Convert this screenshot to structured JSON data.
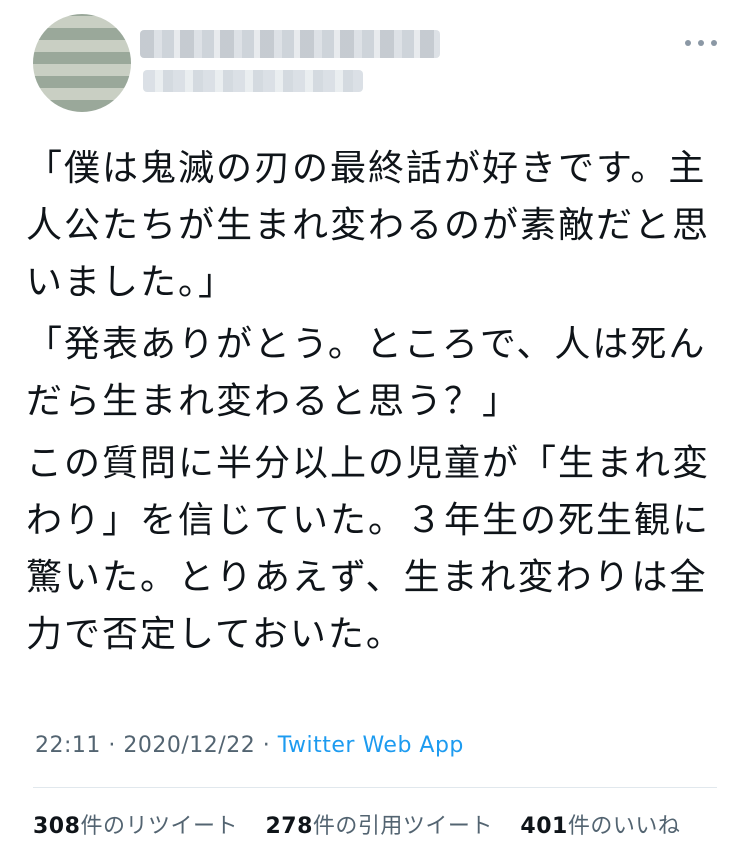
{
  "tweet": {
    "paragraphs": [
      "「僕は鬼滅の刃の最終話が好きです。主人公たちが生まれ変わるのが素敵だと思いました。」",
      "「発表ありがとう。ところで、人は死んだら生まれ変わると思う？」",
      "この質問に半分以上の児童が「生まれ変わり」を信じていた。３年生の死生観に驚いた。とりあえず、生まれ変わりは全力で否定しておいた。"
    ],
    "time": "22:11",
    "date": "2020/12/22",
    "separator": "·",
    "source": "Twitter Web App"
  },
  "stats": {
    "retweets_count": "308",
    "retweets_label": "件のリツイート",
    "quotes_count": "278",
    "quotes_label": "件の引用ツイート",
    "likes_count": "401",
    "likes_label": "件のいいね"
  },
  "colors": {
    "text": "#0f1419",
    "secondary": "#536471",
    "link": "#1d9bf0"
  },
  "icons": {
    "more": "more-horizontal-icon"
  }
}
